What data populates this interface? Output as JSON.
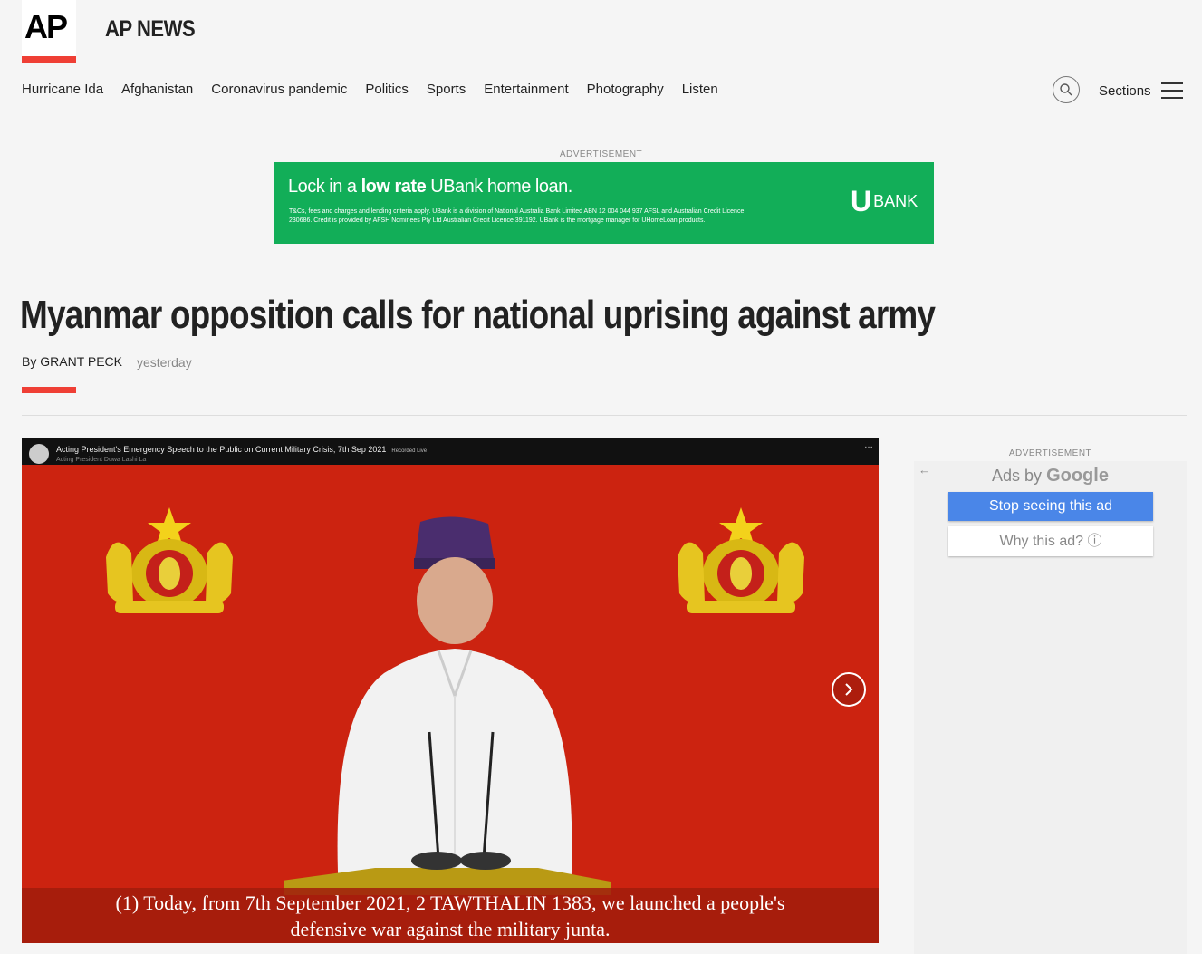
{
  "header": {
    "logo_text": "AP",
    "brand": "AP NEWS",
    "nav_items": [
      "Hurricane Ida",
      "Afghanistan",
      "Coronavirus pandemic",
      "Politics",
      "Sports",
      "Entertainment",
      "Photography",
      "Listen"
    ],
    "sections_label": "Sections"
  },
  "top_ad": {
    "label": "ADVERTISEMENT",
    "headline_pre": "Lock in a ",
    "headline_bold": "low rate",
    "headline_post": " UBank home loan.",
    "fine_print": "T&Cs, fees and charges and lending criteria apply. UBank is a division of National Australia Bank Limited ABN 12 004 044 937 AFSL and Australian Credit Licence 230686. Credit is provided by AFSH Nominees Pty Ltd Australian Credit Licence 391192. UBank is the mortgage manager for UHomeLoan products.",
    "brand_u": "U",
    "brand_text": "BANK",
    "bg_color": "#12ae58"
  },
  "article": {
    "title": "Myanmar opposition calls for national uprising against army",
    "byline": "By GRANT PECK",
    "timestamp": "yesterday",
    "accent_color": "#ef3f35"
  },
  "media": {
    "video_title": "Acting President's Emergency Speech to the Public on Current Military Crisis, 7th Sep 2021",
    "video_tag": "Recorded Live",
    "channel": "Acting President Duwa Lashi La",
    "subtitle_line1": "(1) Today, from 7th September 2021, 2 TAWTHALIN 1383, we launched a people's",
    "subtitle_line2": "defensive war against the military junta.",
    "bg_color": "#cc2310",
    "more_icon": "…"
  },
  "side_ad": {
    "label": "ADVERTISEMENT",
    "back_icon": "←",
    "ads_by": "Ads by ",
    "google": "Google",
    "stop_label": "Stop seeing this ad",
    "why_label": "Why this ad? ⓘ"
  }
}
